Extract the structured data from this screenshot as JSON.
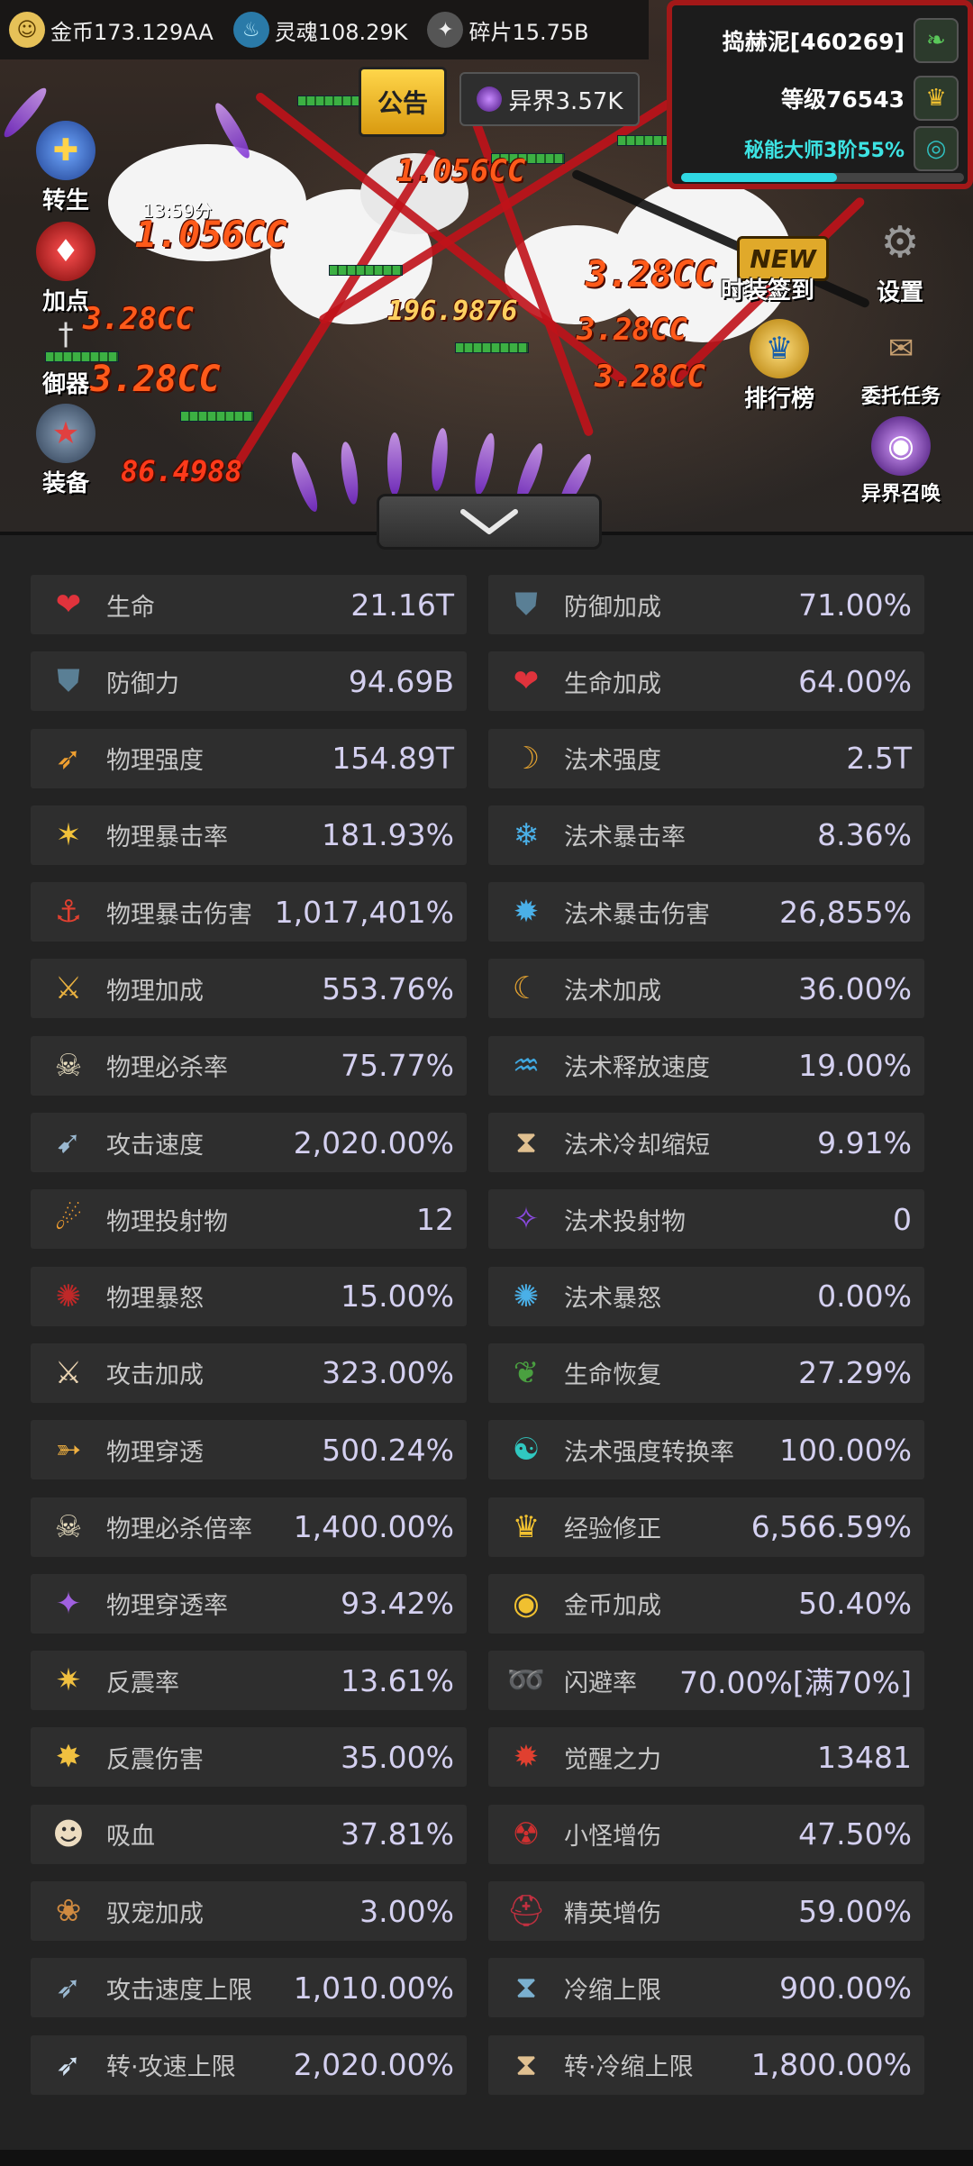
{
  "resources": {
    "gold": "金币173.129AA",
    "soul": "灵魂108.29K",
    "shard": "碎片15.75B"
  },
  "top": {
    "notice": "公告",
    "otherworld": "异界3.57K"
  },
  "player": {
    "name": "捣赫泥[460269]",
    "level": "等级76543",
    "mastery": "秘能大师3阶55%",
    "mastery_progress": 0.55
  },
  "left_buttons": [
    "转生",
    "加点",
    "御器",
    "装备"
  ],
  "right_buttons": {
    "fashion_signin": "时装签到",
    "settings": "设置",
    "new_badge": "NEW",
    "ranking": "排行榜",
    "commission": "委托任务",
    "otherworld_summon": "异界召唤"
  },
  "timer": "13:59分",
  "damage_numbers": [
    "1.056CC",
    "1.056CC",
    "196.9876",
    "3.28CC",
    "3.28CC",
    "3.28CC",
    "3.28CC",
    "86.4988",
    "3.28CC"
  ],
  "stats_left": [
    {
      "icon": "heart-icon",
      "label": "生命",
      "value": "21.16T"
    },
    {
      "icon": "shield-icon",
      "label": "防御力",
      "value": "94.69B"
    },
    {
      "icon": "arrow-strength-icon",
      "label": "物理强度",
      "value": "154.89T"
    },
    {
      "icon": "crit-icon",
      "label": "物理暴击率",
      "value": "181.93%"
    },
    {
      "icon": "crit-damage-icon",
      "label": "物理暴击伤害",
      "value": "1,017,401%"
    },
    {
      "icon": "sword-plus-icon",
      "label": "物理加成",
      "value": "553.76%"
    },
    {
      "icon": "skull-icon",
      "label": "物理必杀率",
      "value": "75.77%"
    },
    {
      "icon": "attack-speed-icon",
      "label": "攻击速度",
      "value": "2,020.00%"
    },
    {
      "icon": "projectile-icon",
      "label": "物理投射物",
      "value": "12"
    },
    {
      "icon": "rage-icon",
      "label": "物理暴怒",
      "value": "15.00%"
    },
    {
      "icon": "crossed-swords-icon",
      "label": "攻击加成",
      "value": "323.00%"
    },
    {
      "icon": "pierce-icon",
      "label": "物理穿透",
      "value": "500.24%"
    },
    {
      "icon": "skull-multiplier-icon",
      "label": "物理必杀倍率",
      "value": "1,400.00%"
    },
    {
      "icon": "pierce-rate-icon",
      "label": "物理穿透率",
      "value": "93.42%"
    },
    {
      "icon": "reflect-icon",
      "label": "反震率",
      "value": "13.61%"
    },
    {
      "icon": "reflect-damage-icon",
      "label": "反震伤害",
      "value": "35.00%"
    },
    {
      "icon": "vampire-icon",
      "label": "吸血",
      "value": "37.81%"
    },
    {
      "icon": "paw-icon",
      "label": "驭宠加成",
      "value": "3.00%"
    },
    {
      "icon": "speed-cap-icon",
      "label": "攻击速度上限",
      "value": "1,010.00%"
    },
    {
      "icon": "speed-cap-convert-icon",
      "label": "转·攻速上限",
      "value": "2,020.00%"
    }
  ],
  "stats_right": [
    {
      "icon": "shield-plus-icon",
      "label": "防御加成",
      "value": "71.00%"
    },
    {
      "icon": "heart-plus-icon",
      "label": "生命加成",
      "value": "64.00%"
    },
    {
      "icon": "magic-strength-icon",
      "label": "法术强度",
      "value": "2.5T"
    },
    {
      "icon": "magic-crit-icon",
      "label": "法术暴击率",
      "value": "8.36%"
    },
    {
      "icon": "magic-crit-damage-icon",
      "label": "法术暴击伤害",
      "value": "26,855%"
    },
    {
      "icon": "magic-plus-icon",
      "label": "法术加成",
      "value": "36.00%"
    },
    {
      "icon": "cast-speed-icon",
      "label": "法术释放速度",
      "value": "19.00%"
    },
    {
      "icon": "hourglass-icon",
      "label": "法术冷却缩短",
      "value": "9.91%"
    },
    {
      "icon": "magic-projectile-icon",
      "label": "法术投射物",
      "value": "0"
    },
    {
      "icon": "magic-rage-icon",
      "label": "法术暴怒",
      "value": "0.00%"
    },
    {
      "icon": "leaf-icon",
      "label": "生命恢复",
      "value": "27.29%"
    },
    {
      "icon": "conversion-icon",
      "label": "法术强度转换率",
      "value": "100.00%"
    },
    {
      "icon": "crown-icon",
      "label": "经验修正",
      "value": "6,566.59%"
    },
    {
      "icon": "coins-icon",
      "label": "金币加成",
      "value": "50.40%"
    },
    {
      "icon": "dodge-icon",
      "label": "闪避率",
      "value": "70.00%[满70%]"
    },
    {
      "icon": "awaken-icon",
      "label": "觉醒之力",
      "value": "13481"
    },
    {
      "icon": "demon-icon",
      "label": "小怪增伤",
      "value": "47.50%"
    },
    {
      "icon": "elite-helmet-icon",
      "label": "精英增伤",
      "value": "59.00%"
    },
    {
      "icon": "cooldown-cap-icon",
      "label": "冷缩上限",
      "value": "900.00%"
    },
    {
      "icon": "cooldown-cap-convert-icon",
      "label": "转·冷缩上限",
      "value": "1,800.00%"
    }
  ],
  "icon_glyphs": {
    "heart-icon": "❤",
    "shield-icon": "⛊",
    "arrow-strength-icon": "➶",
    "crit-icon": "✶",
    "crit-damage-icon": "⚓",
    "sword-plus-icon": "⚔",
    "skull-icon": "☠",
    "attack-speed-icon": "➹",
    "projectile-icon": "☄",
    "rage-icon": "✺",
    "crossed-swords-icon": "⚔",
    "pierce-icon": "➳",
    "skull-multiplier-icon": "☠",
    "pierce-rate-icon": "✦",
    "reflect-icon": "✷",
    "reflect-damage-icon": "✸",
    "vampire-icon": "☻",
    "paw-icon": "❀",
    "speed-cap-icon": "➶",
    "speed-cap-convert-icon": "➶",
    "shield-plus-icon": "⛊",
    "heart-plus-icon": "❤",
    "magic-strength-icon": "☽",
    "magic-crit-icon": "❄",
    "magic-crit-damage-icon": "✹",
    "magic-plus-icon": "☾",
    "cast-speed-icon": "♒",
    "hourglass-icon": "⧗",
    "magic-projectile-icon": "✧",
    "magic-rage-icon": "✺",
    "leaf-icon": "❦",
    "conversion-icon": "☯",
    "crown-icon": "♛",
    "coins-icon": "◉",
    "dodge-icon": "➿",
    "awaken-icon": "✹",
    "demon-icon": "☢",
    "elite-helmet-icon": "⛑",
    "cooldown-cap-icon": "⧗",
    "cooldown-cap-convert-icon": "⧗"
  },
  "icon_colors": {
    "heart-icon": "#e0333c",
    "shield-icon": "#5a7f95",
    "arrow-strength-icon": "#f0a030",
    "crit-icon": "#f2c23a",
    "crit-damage-icon": "#e04030",
    "sword-plus-icon": "#e8b040",
    "skull-icon": "#e9dfc0",
    "attack-speed-icon": "#9ab8d0",
    "projectile-icon": "#f5a030",
    "rage-icon": "#c02828",
    "crossed-swords-icon": "#e8d2b0",
    "pierce-icon": "#f0b040",
    "skull-multiplier-icon": "#e9dfc0",
    "pierce-rate-icon": "#a060e0",
    "reflect-icon": "#f0c040",
    "reflect-damage-icon": "#f0c040",
    "vampire-icon": "#ecdcc0",
    "paw-icon": "#d08a40",
    "speed-cap-icon": "#9ab8d0",
    "speed-cap-convert-icon": "#d0e0f0",
    "shield-plus-icon": "#5a7f95",
    "heart-plus-icon": "#e0333c",
    "magic-strength-icon": "#e0a030",
    "magic-crit-icon": "#4ab0e8",
    "magic-crit-damage-icon": "#4ab0e8",
    "magic-plus-icon": "#e0a030",
    "cast-speed-icon": "#40a8e0",
    "hourglass-icon": "#e0c090",
    "magic-projectile-icon": "#8a4ae0",
    "magic-rage-icon": "#4ab0e8",
    "leaf-icon": "#4aa040",
    "conversion-icon": "#30c8c0",
    "crown-icon": "#f0c030",
    "coins-icon": "#f0c030",
    "dodge-icon": "#30c0c0",
    "awaken-icon": "#e04030",
    "demon-icon": "#d03030",
    "elite-helmet-icon": "#c03040",
    "cooldown-cap-icon": "#7ab0d0",
    "cooldown-cap-convert-icon": "#e0c090"
  }
}
